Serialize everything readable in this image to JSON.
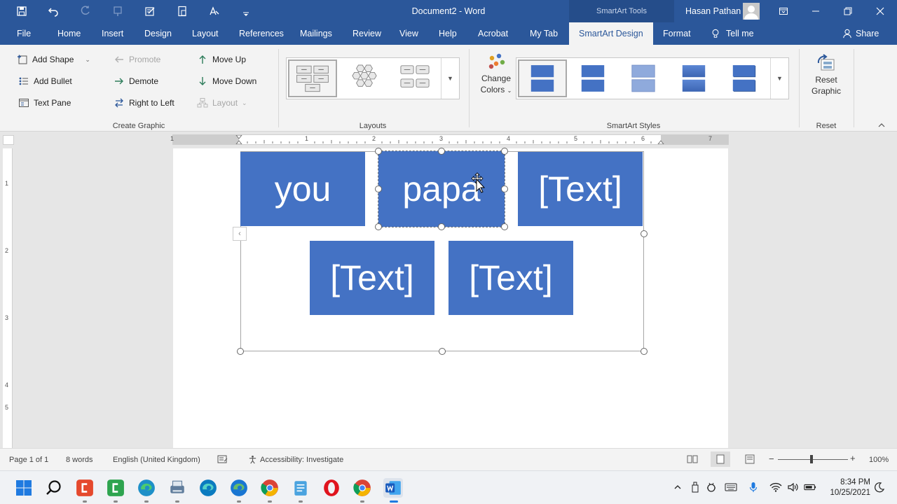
{
  "window": {
    "doc_title": "Document2  -  Word",
    "tools_label": "SmartArt Tools",
    "user_name": "Hasan Pathan"
  },
  "tabs": [
    "File",
    "Home",
    "Insert",
    "Design",
    "Layout",
    "References",
    "Mailings",
    "Review",
    "View",
    "Help",
    "Acrobat",
    "My Tab",
    "SmartArt Design",
    "Format"
  ],
  "active_tab": "SmartArt Design",
  "tell_me": "Tell me",
  "share": "Share",
  "ribbon": {
    "create_graphic": {
      "label": "Create Graphic",
      "add_shape": "Add Shape",
      "add_bullet": "Add Bullet",
      "text_pane": "Text Pane",
      "promote": "Promote",
      "demote": "Demote",
      "right_to_left": "Right to Left",
      "move_up": "Move Up",
      "move_down": "Move Down",
      "layout": "Layout"
    },
    "layouts": {
      "label": "Layouts"
    },
    "smartart_styles": {
      "label": "SmartArt Styles",
      "change_colors_1": "Change",
      "change_colors_2": "Colors"
    },
    "reset": {
      "label": "Reset",
      "reset_graphic_1": "Reset",
      "reset_graphic_2": "Graphic"
    }
  },
  "ruler": {
    "h_numbers": [
      "1",
      "1",
      "2",
      "3",
      "4",
      "5",
      "6",
      "7"
    ],
    "v_numbers": [
      "1",
      "2",
      "3",
      "4",
      "5"
    ]
  },
  "smartart": {
    "boxes": [
      "you",
      "papa",
      "[Text]",
      "[Text]",
      "[Text]"
    ],
    "fill_color": "#4472c4"
  },
  "status": {
    "page": "Page 1 of 1",
    "words": "8 words",
    "language": "English (United Kingdom)",
    "accessibility": "Accessibility: Investigate",
    "zoom": "100%"
  },
  "taskbar": {
    "time": "8:34 PM",
    "date": "10/25/2021"
  }
}
